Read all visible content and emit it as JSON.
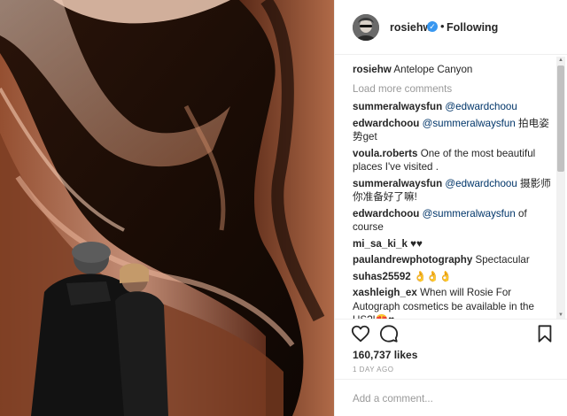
{
  "header": {
    "username": "rosiehw",
    "separator": "•",
    "follow_status": "Following"
  },
  "caption": {
    "username": "rosiehw",
    "text": "Antelope Canyon"
  },
  "load_more": "Load more comments",
  "comments": [
    {
      "user": "summeralwaysfun",
      "mention": "@edwardchoou",
      "text": ""
    },
    {
      "user": "edwardchoou",
      "mention": "@summeralwaysfun",
      "text": "拍电姿势get"
    },
    {
      "user": "voula.roberts",
      "mention": "",
      "text": "One of the most beautiful places I've visited ."
    },
    {
      "user": "summeralwaysfun",
      "mention": "@edwardchoou",
      "text": "摄影师你准备好了嘛!"
    },
    {
      "user": "edwardchoou",
      "mention": "@summeralwaysfun",
      "text": "of course"
    },
    {
      "user": "mi_sa_ki_k",
      "mention": "",
      "text": "♥♥"
    },
    {
      "user": "paulandrewphotography",
      "mention": "",
      "text": "Spectacular"
    },
    {
      "user": "suhas25592",
      "mention": "",
      "text": "👌👌👌"
    },
    {
      "user": "xashleigh_ex",
      "mention": "",
      "text": "When will Rosie For Autograph cosmetics be available in the US?!😍♥"
    }
  ],
  "actions": {
    "like_icon": "heart-outline-icon",
    "comment_icon": "comment-bubble-icon",
    "save_icon": "bookmark-icon"
  },
  "likes": "160,737 likes",
  "timestamp": "1 DAY AGO",
  "add_comment": {
    "placeholder": "Add a comment..."
  },
  "colors": {
    "verified": "#3897f0",
    "mention": "#003569",
    "muted": "#999999"
  }
}
